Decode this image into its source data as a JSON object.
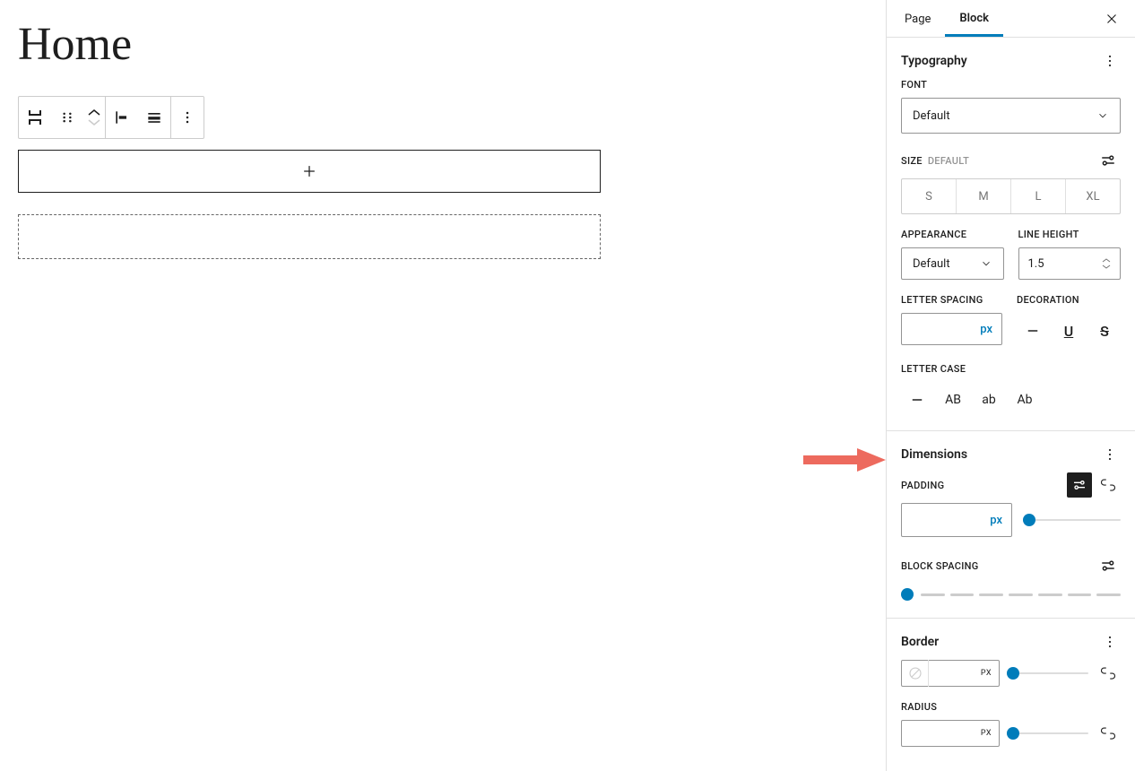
{
  "page_title": "Home",
  "tabs": {
    "page": "Page",
    "block": "Block",
    "active": "Block"
  },
  "typography": {
    "title": "Typography",
    "font_label": "FONT",
    "font_value": "Default",
    "size_label": "SIZE",
    "size_default": "DEFAULT",
    "sizes": [
      "S",
      "M",
      "L",
      "XL"
    ],
    "appearance_label": "APPEARANCE",
    "appearance_value": "Default",
    "lineheight_label": "LINE HEIGHT",
    "lineheight_value": "1.5",
    "letterspacing_label": "LETTER SPACING",
    "letterspacing_unit": "px",
    "decoration_label": "DECORATION",
    "lettercase_label": "LETTER CASE",
    "lettercase_options": [
      "AB",
      "ab",
      "Ab"
    ]
  },
  "dimensions": {
    "title": "Dimensions",
    "padding_label": "PADDING",
    "padding_unit": "px",
    "blockspacing_label": "BLOCK SPACING"
  },
  "border": {
    "title": "Border",
    "width_unit": "PX",
    "radius_label": "RADIUS",
    "radius_unit": "PX"
  }
}
